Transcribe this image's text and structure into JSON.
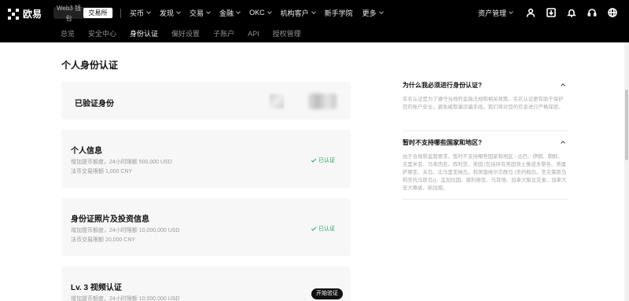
{
  "topbar": {
    "brand": "欧易",
    "mode_web3": "Web3 钱包",
    "mode_exchange": "交易所",
    "nav": [
      {
        "label": "买币"
      },
      {
        "label": "发现"
      },
      {
        "label": "交易"
      },
      {
        "label": "金融"
      },
      {
        "label": "OKC"
      },
      {
        "label": "机构客户"
      },
      {
        "label": "新手学院"
      },
      {
        "label": "更多"
      }
    ],
    "asset_menu": "资产管理",
    "icons": [
      "user-icon",
      "download-icon",
      "bell-icon",
      "headset-icon",
      "globe-icon"
    ]
  },
  "subnav": {
    "items": [
      {
        "label": "总览"
      },
      {
        "label": "安全中心"
      },
      {
        "label": "身份认证",
        "active": true
      },
      {
        "label": "偏好设置"
      },
      {
        "label": "子账户"
      },
      {
        "label": "API"
      },
      {
        "label": "授权管理"
      }
    ]
  },
  "main": {
    "page_title": "个人身份认证",
    "verified_label": "已验证身份",
    "levels": [
      {
        "title": "个人信息",
        "line1": "增加提币额度，24小时限额 500,000 USD",
        "line2": "法币交易限额 1,000 CNY",
        "status": "已认证"
      },
      {
        "title": "身份证照片及投资信息",
        "line1": "增加提币额度，24小时限额 10,000,000 USD",
        "line2": "法币交易限额 20,000 CNY",
        "status": "已认证"
      },
      {
        "title": "Lv. 3 视频认证",
        "line1": "增加提币额度，24小时限额 10,000,000 USD",
        "action": "开始验证"
      }
    ]
  },
  "faq": [
    {
      "question": "为什么我必须进行身份认证?",
      "answer": "实名认证是为了遵守当地的金融法规和相关政策。实名认证更有助于保护您的账户安全，避免被欺骗诈骗手段。我们将对您的信息进行严格保密。"
    },
    {
      "question": "暂时不支持哪些国家和地区?",
      "answer": "由于合规和监管要求，暂时不支持哪些国家和地区 - 古巴、伊朗、朝鲜、克里米亚、马来西亚、叙利亚、美国 [包括所有美国领土像波多黎各、美属萨摩亚、关岛、北马里亚纳岛，和美国维尔京群岛 (圣约翰岛，圣克鲁斯岛和圣托马斯岛)]、孟加拉国、玻利维亚、马耳他、加拿大魁北克省、加拿大安大略省、新加坡。"
    }
  ],
  "colors": {
    "nav_bg": "#000000",
    "verified_green": "#21a35c",
    "card_bg": "#f7f7f8"
  }
}
